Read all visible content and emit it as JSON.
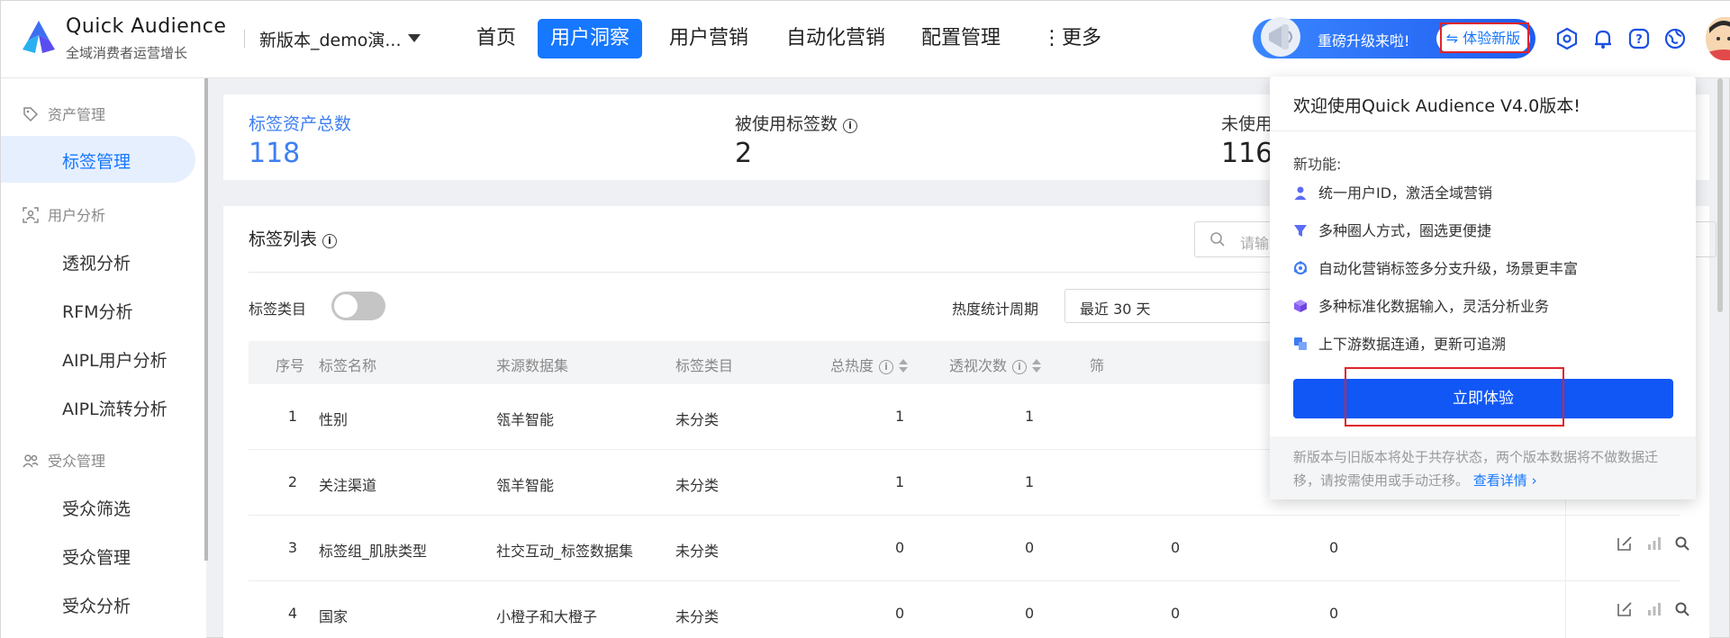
{
  "brand": {
    "name": "Quick Audience",
    "subtitle": "全域消费者运营增长"
  },
  "tenant": {
    "label": "新版本_demo演..."
  },
  "nav": [
    {
      "label": "首页"
    },
    {
      "label": "用户洞察",
      "active": true
    },
    {
      "label": "用户营销"
    },
    {
      "label": "自动化营销"
    },
    {
      "label": "配置管理"
    },
    {
      "label": "⋮更多"
    }
  ],
  "promo": {
    "text": "重磅升级来啦!",
    "button": "⇋ 体验新版"
  },
  "header_icons": [
    "settings-hex-icon",
    "bell-icon",
    "help-icon",
    "globe-icon"
  ],
  "sidebar": {
    "groups": [
      {
        "label": "资产管理",
        "icon": "tag-icon",
        "items": [
          {
            "label": "标签管理",
            "active": true
          }
        ]
      },
      {
        "label": "用户分析",
        "icon": "user-scan-icon",
        "items": [
          {
            "label": "透视分析"
          },
          {
            "label": "RFM分析"
          },
          {
            "label": "AIPL用户分析"
          },
          {
            "label": "AIPL流转分析"
          }
        ]
      },
      {
        "label": "受众管理",
        "icon": "users-icon",
        "items": [
          {
            "label": "受众筛选"
          },
          {
            "label": "受众管理"
          },
          {
            "label": "受众分析"
          }
        ]
      }
    ]
  },
  "stats": [
    {
      "label": "标签资产总数",
      "value": "118"
    },
    {
      "label": "被使用标签数",
      "value": "2"
    },
    {
      "label": "未使用",
      "value": "116"
    }
  ],
  "list": {
    "title": "标签列表",
    "search_placeholder": "请输",
    "category_label": "标签类目",
    "period_label": "热度统计周期",
    "period_value": "最近 30 天",
    "columns": [
      "序号",
      "标签名称",
      "来源数据集",
      "标签类目",
      "总热度",
      "透视次数",
      "筛"
    ],
    "rows": [
      {
        "no": "1",
        "name": "性别",
        "source": "瓴羊智能",
        "category": "未分类",
        "heat": "1",
        "views": "1",
        "filter": "",
        "extra": ""
      },
      {
        "no": "2",
        "name": "关注渠道",
        "source": "瓴羊智能",
        "category": "未分类",
        "heat": "1",
        "views": "1",
        "filter": "",
        "extra": ""
      },
      {
        "no": "3",
        "name": "标签组_肌肤类型",
        "source": "社交互动_标签数据集",
        "category": "未分类",
        "heat": "0",
        "views": "0",
        "filter": "0",
        "extra": "0"
      },
      {
        "no": "4",
        "name": "国家",
        "source": "小橙子和大橙子",
        "category": "未分类",
        "heat": "0",
        "views": "0",
        "filter": "0",
        "extra": "0"
      }
    ]
  },
  "popup": {
    "title": "欢迎使用Quick Audience V4.0版本!",
    "new_label": "新功能:",
    "features": [
      {
        "icon": "person-icon",
        "color": "#5b6cf5",
        "text": "统一用户ID，激活全域营销"
      },
      {
        "icon": "funnel-icon",
        "color": "#5b6cf5",
        "text": "多种圈人方式，圈选更便捷"
      },
      {
        "icon": "automation-icon",
        "color": "#3d7bf5",
        "text": "自动化营销标签多分支升级，场景更丰富"
      },
      {
        "icon": "cube-icon",
        "color": "#8a5cf5",
        "text": "多种标准化数据输入，灵活分析业务"
      },
      {
        "icon": "flow-icon",
        "color": "#3d7bf5",
        "text": "上下游数据连通，更新可追溯"
      }
    ],
    "button": "立即体验",
    "footer_text": "新版本与旧版本将处于共存状态，两个版本数据将不做数据迁移，请按需使用或手动迁移。",
    "footer_link": "查看详情 ›"
  }
}
